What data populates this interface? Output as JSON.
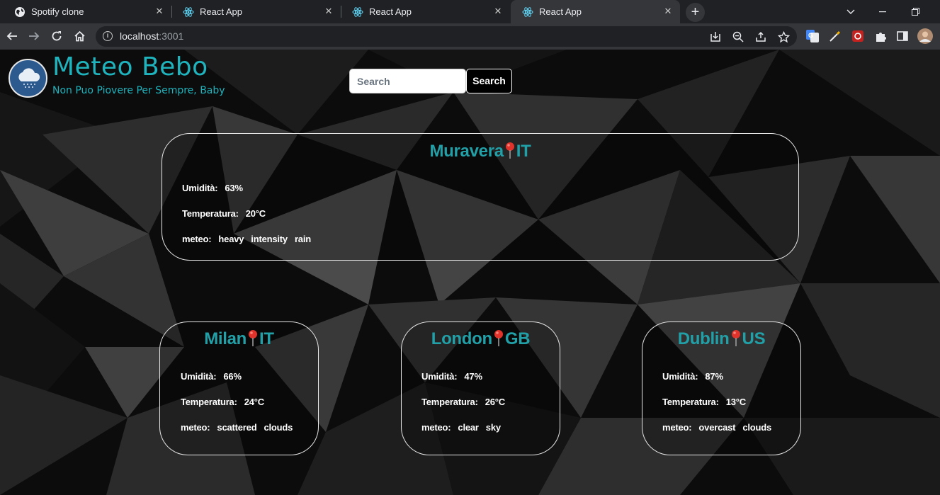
{
  "browser": {
    "tabs": [
      {
        "title": "Spotify clone",
        "icon": "globe-icon"
      },
      {
        "title": "React App",
        "icon": "react-icon"
      },
      {
        "title": "React App",
        "icon": "react-icon"
      },
      {
        "title": "React App",
        "icon": "react-icon"
      }
    ],
    "active_tab": 3,
    "url_host": "localhost",
    "url_port": ":3001"
  },
  "header": {
    "title": "Meteo Bebo",
    "subtitle": "Non Puo Piovere Per Sempre, Baby",
    "logo_icon": "cloud-rain-icon"
  },
  "search": {
    "placeholder": "Search",
    "button_label": "Search"
  },
  "labels": {
    "humidity": "Umidità:",
    "temperature": "Temperatura:",
    "weather": "meteo:"
  },
  "main_city": {
    "city": "Muravera",
    "country": "IT",
    "humidity": "63%",
    "temperature": "20°C",
    "weather": [
      "heavy",
      "intensity",
      "rain"
    ]
  },
  "cities": [
    {
      "city": "Milan",
      "country": "IT",
      "humidity": "66%",
      "temperature": "24°C",
      "weather": [
        "scattered",
        "clouds"
      ]
    },
    {
      "city": "London",
      "country": "GB",
      "humidity": "47%",
      "temperature": "26°C",
      "weather": [
        "clear",
        "sky"
      ]
    },
    {
      "city": "Dublin",
      "country": "US",
      "humidity": "87%",
      "temperature": "13°C",
      "weather": [
        "overcast",
        "clouds"
      ]
    }
  ],
  "colors": {
    "accent": "#1fb3bd",
    "card_title": "#22a0a8",
    "background": "#0b0b0b"
  }
}
